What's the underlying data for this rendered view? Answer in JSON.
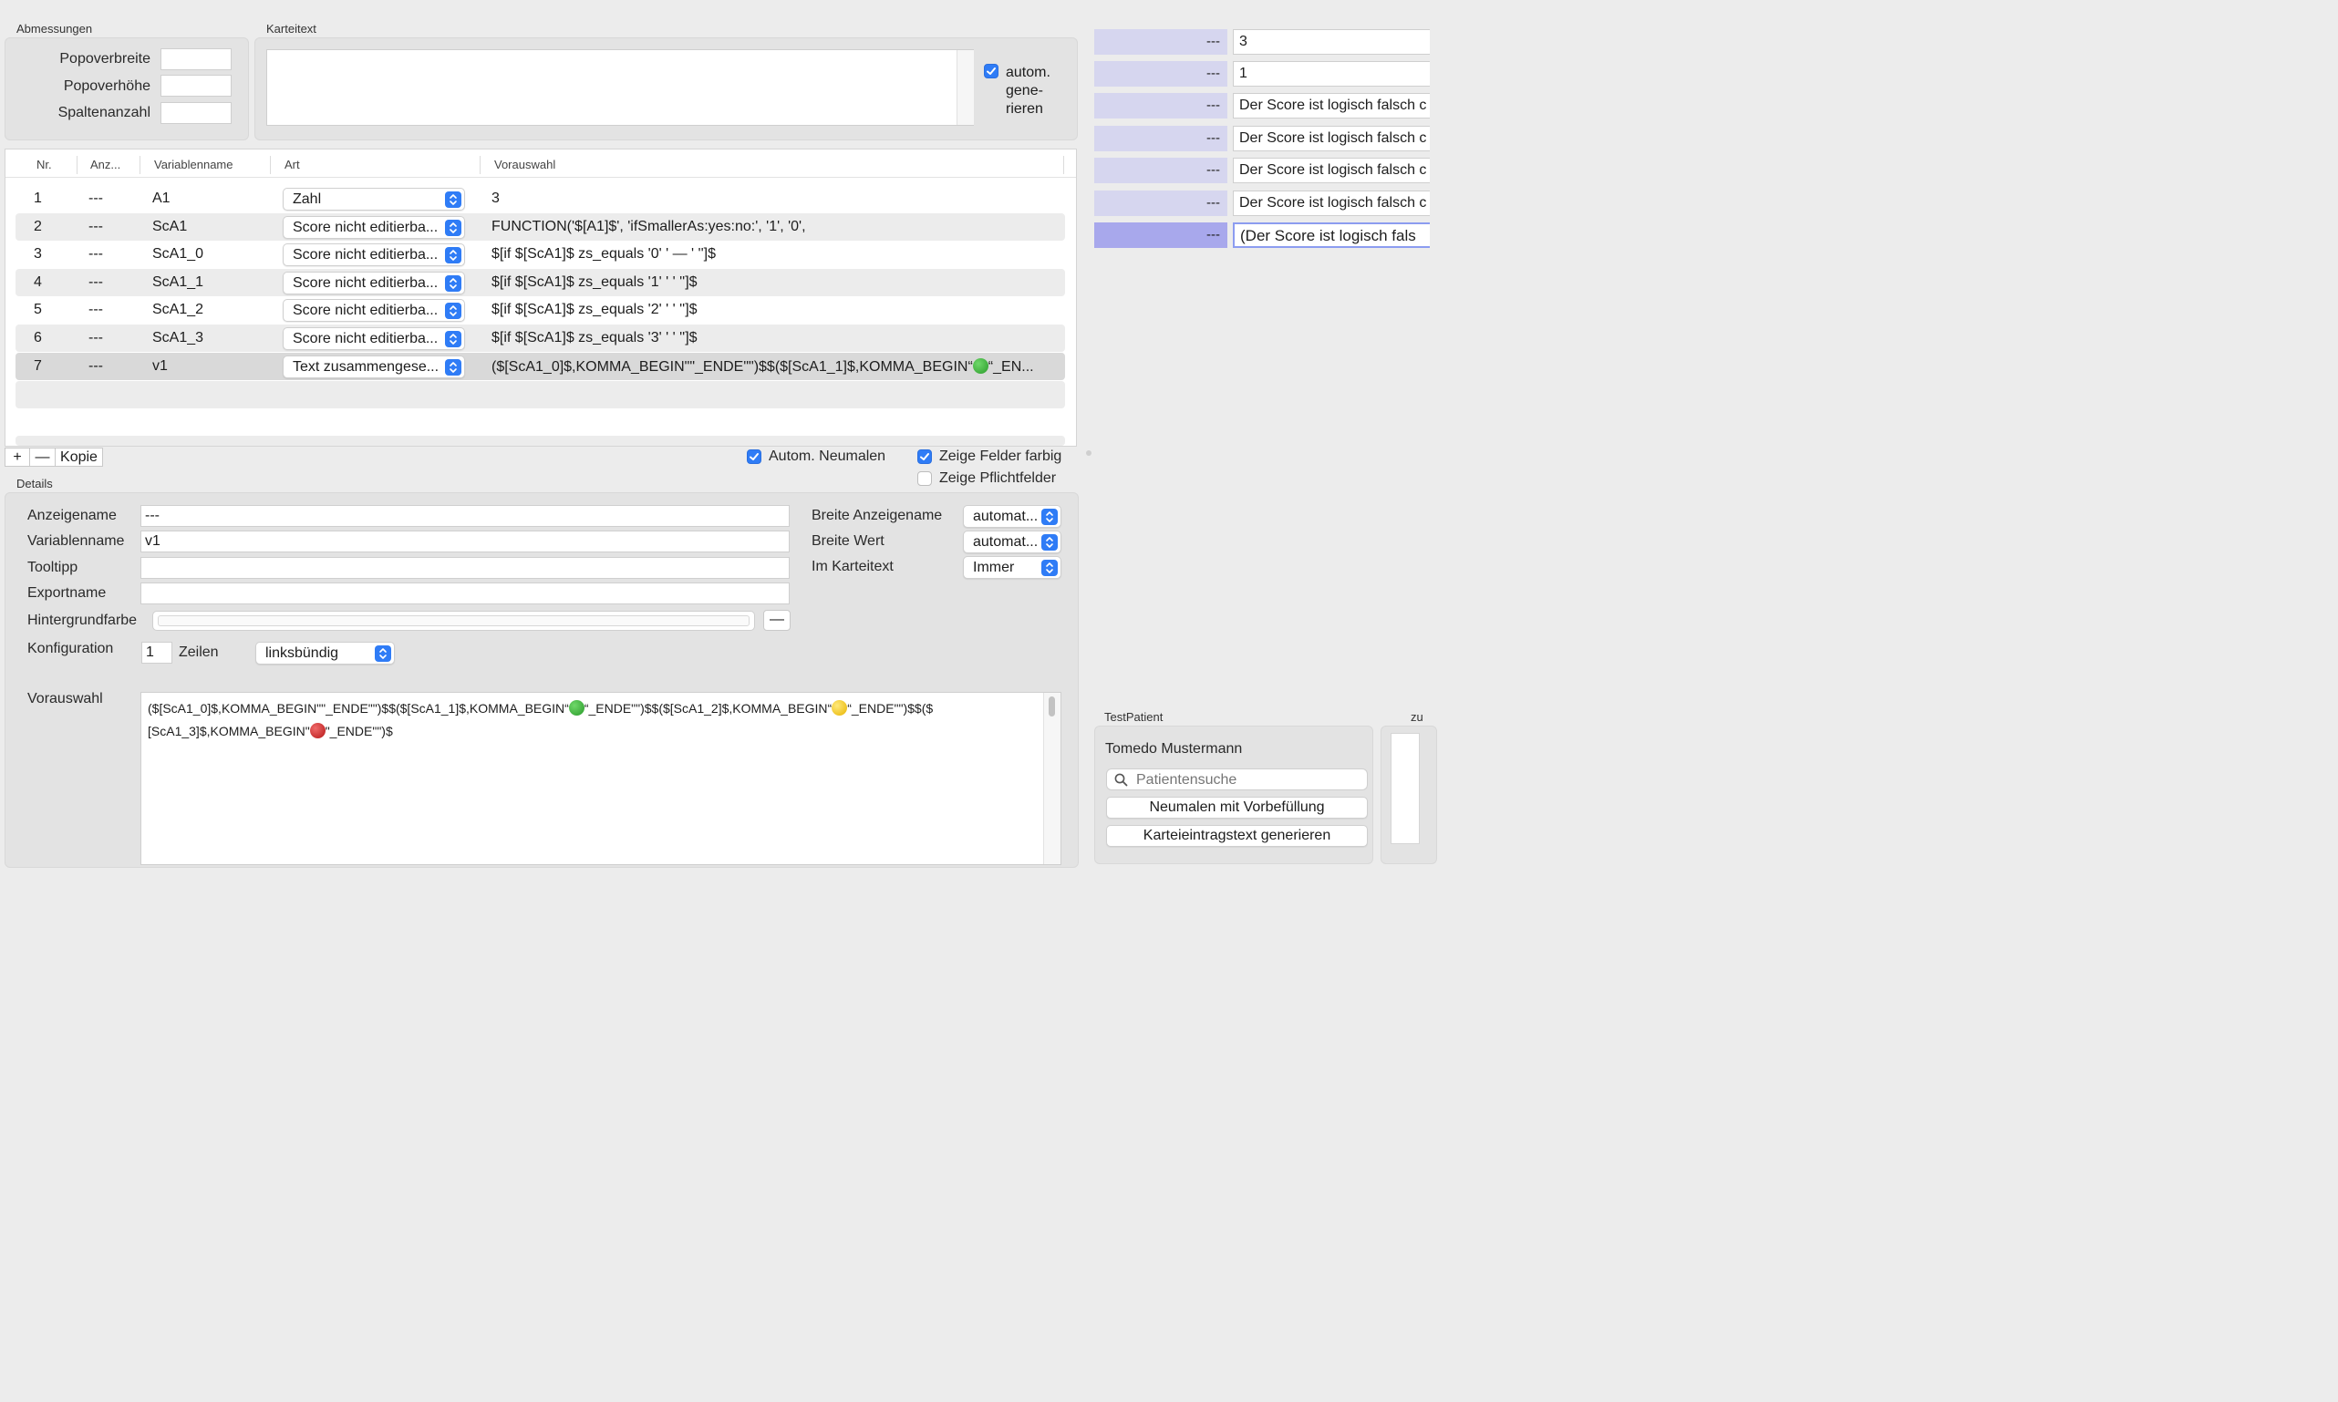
{
  "dimensions": {
    "section_label": "Abmessungen",
    "popover_width_label": "Popoverbreite",
    "popover_width_value": "",
    "popover_height_label": "Popoverhöhe",
    "popover_height_value": "",
    "column_count_label": "Spaltenanzahl",
    "column_count_value": ""
  },
  "record_text": {
    "section_label": "Karteitext",
    "value": "",
    "auto_generate_checked": true,
    "auto_generate_line1": "autom.",
    "auto_generate_line2": "gene-",
    "auto_generate_line3": "rieren"
  },
  "table": {
    "headers": {
      "nr": "Nr.",
      "display": "Anz...",
      "variable": "Variablenname",
      "type": "Art",
      "preselection": "Vorauswahl"
    },
    "rows": [
      {
        "nr": "1",
        "display": "---",
        "variable": "A1",
        "type": "Zahl",
        "preselection": "3"
      },
      {
        "nr": "2",
        "display": "---",
        "variable": "ScA1",
        "type": "Score nicht editierba...",
        "preselection": "FUNCTION('$[A1]$', 'ifSmallerAs:yes:no:', '1', '0',"
      },
      {
        "nr": "3",
        "display": "---",
        "variable": "ScA1_0",
        "type": "Score nicht editierba...",
        "preselection": "$[if $[ScA1]$ zs_equals '0' ' — ' '']$"
      },
      {
        "nr": "4",
        "display": "---",
        "variable": "ScA1_1",
        "type": "Score nicht editierba...",
        "preselection": "$[if $[ScA1]$ zs_equals '1' ' ' '']$"
      },
      {
        "nr": "5",
        "display": "---",
        "variable": "ScA1_2",
        "type": "Score nicht editierba...",
        "preselection": "$[if $[ScA1]$ zs_equals '2' ' ' '']$"
      },
      {
        "nr": "6",
        "display": "---",
        "variable": "ScA1_3",
        "type": "Score nicht editierba...",
        "preselection": "$[if $[ScA1]$ zs_equals '3' ' ' '']$"
      },
      {
        "nr": "7",
        "display": "---",
        "variable": "v1",
        "type": "Text zusammengese...",
        "preselection_before": "($[ScA1_0]$,KOMMA_BEGIN\"\"_ENDE\"\")$$($[ScA1_1]$,KOMMA_BEGIN“",
        "preselection_after": "“_EN..."
      }
    ],
    "add_button": "+",
    "remove_button": "—",
    "copy_button": "Kopie"
  },
  "options": {
    "auto_repaint_label": "Autom. Neumalen",
    "auto_repaint_checked": true,
    "show_colored_label": "Zeige Felder farbig",
    "show_colored_checked": true,
    "show_required_label": "Zeige Pflichtfelder",
    "show_required_checked": false
  },
  "details": {
    "section_label": "Details",
    "display_name_label": "Anzeigename",
    "display_name_value": "---",
    "variable_name_label": "Variablenname",
    "variable_name_value": "v1",
    "tooltip_label": "Tooltipp",
    "tooltip_value": "",
    "export_name_label": "Exportname",
    "export_name_value": "",
    "background_color_label": "Hintergrundfarbe",
    "background_remove_button": "—",
    "config_label": "Konfiguration",
    "config_rows_value": "1",
    "config_rows_unit": "Zeilen",
    "alignment_value": "linksbündig",
    "width_display_label": "Breite Anzeigename",
    "width_display_value": "automat...",
    "width_value_label": "Breite Wert",
    "width_value_value": "automat...",
    "in_record_label": "Im Karteitext",
    "in_record_value": "Immer",
    "preselection_label": "Vorauswahl",
    "preselection_line1_a": "($[ScA1_0]$,KOMMA_BEGIN\"\"_ENDE\"\")$$($[ScA1_1]$,KOMMA_BEGIN“",
    "preselection_line1_b": "“_ENDE\"\")$$($[ScA1_2]$,KOMMA_BEGIN“",
    "preselection_line1_c": "“_ENDE\"\")$$($",
    "preselection_line2_a": "[ScA1_3]$,KOMMA_BEGIN\"",
    "preselection_line2_b": "\"_ENDE\"\")$"
  },
  "preview": {
    "rows": [
      {
        "label": "---",
        "value": "3"
      },
      {
        "label": "---",
        "value": "1"
      },
      {
        "label": "---",
        "value": "Der Score ist logisch falsch c"
      },
      {
        "label": "---",
        "value": "Der Score ist logisch falsch c"
      },
      {
        "label": "---",
        "value": "Der Score ist logisch falsch c"
      },
      {
        "label": "---",
        "value": "Der Score ist logisch falsch c"
      },
      {
        "label": "---",
        "value": "(Der Score ist logisch fals"
      }
    ],
    "colors": {
      "label_bg": "#d6d6ef",
      "selected_label_bg": "#a8a8ec"
    }
  },
  "test_patient": {
    "section_label": "TestPatient",
    "right_label": "zu",
    "patient_name": "Tomedo Mustermann",
    "search_placeholder": "Patientensuche",
    "repaint_button": "Neumalen mit Vorbefüllung",
    "generate_button": "Karteieintragstext generieren"
  }
}
